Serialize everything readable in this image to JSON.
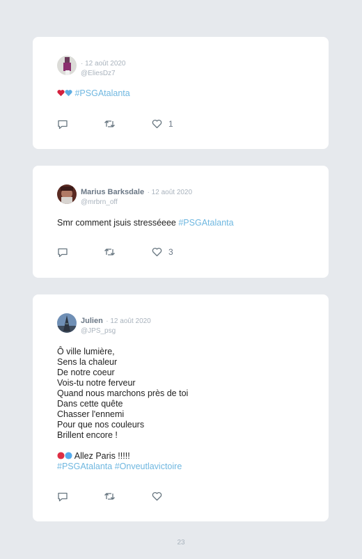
{
  "tweets": [
    {
      "author": "",
      "date": "· 12 août 2020",
      "handle": "@EliesDz7",
      "text": "",
      "hashtags": "#PSGAtalanta",
      "likes": "1"
    },
    {
      "author": "Marius Barksdale",
      "date": "· 12 août 2020",
      "handle": "@mrbrn_off",
      "text": "Smr comment jsuis stresséeee ",
      "hashtags": "#PSGAtalanta",
      "likes": "3"
    },
    {
      "author": "Julien",
      "date": "· 12 août 2020",
      "handle": "@JPS_psg",
      "poem": "Ô ville lumière,\nSens la chaleur\nDe notre coeur\nVois-tu notre ferveur\nQuand nous marchons près de toi\nDans cette quête\nChasser l'ennemi\nPour que nos couleurs\nBrillent encore !",
      "closing": " Allez Paris !!!!!",
      "hashtags": "#PSGAtalanta #Onveutlavictoire",
      "likes": ""
    }
  ],
  "page_number": "23",
  "icons": [
    "reply-icon",
    "retweet-icon",
    "like-icon",
    "heart-emoji",
    "blue-heart-emoji",
    "red-circle-emoji",
    "blue-circle-emoji"
  ],
  "colors": {
    "hashtag": "#6fb7e0",
    "background": "#e6e9ed",
    "card": "#ffffff"
  }
}
